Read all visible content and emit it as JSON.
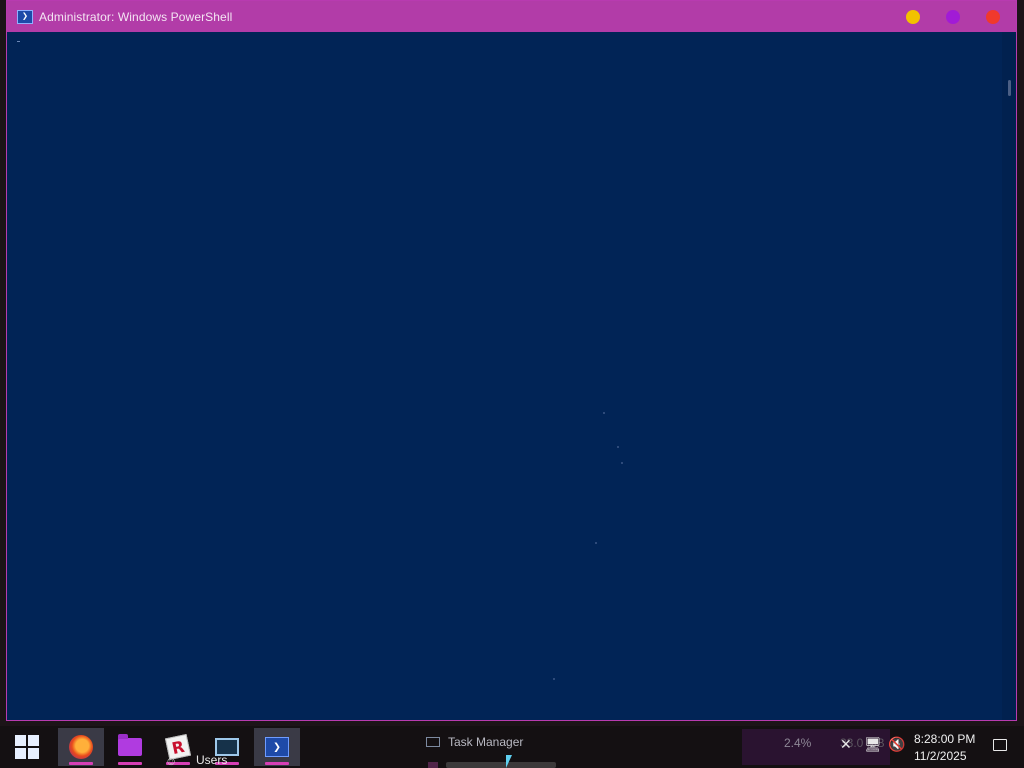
{
  "window": {
    "title": "Administrator: Windows PowerShell",
    "icon": "powershell-icon",
    "colors": {
      "titlebar": "#b23ca8",
      "console_bg": "#012456",
      "minimize": "#f2c200",
      "maximize": "#a11bd6",
      "close": "#f0392c"
    },
    "console_text": ""
  },
  "taskbar": {
    "start_icon": "windows-start-icon",
    "pinned": [
      {
        "name": "firefox",
        "icon": "firefox-icon"
      },
      {
        "name": "file-explorer",
        "icon": "folder-icon"
      },
      {
        "name": "roblox",
        "icon": "roblox-icon"
      },
      {
        "name": "task-manager",
        "icon": "resource-monitor-icon"
      },
      {
        "name": "powershell",
        "icon": "powershell-icon"
      }
    ],
    "users_label": "Users",
    "ghost_window_label": "Task Manager",
    "cpu_value": "2.4%",
    "mem_value": "33.0 MB",
    "accent_color": "#d63fb5"
  },
  "tray": {
    "icons": [
      "chevron-up-icon",
      "network-icon",
      "volume-muted-icon"
    ],
    "time": "8:28:00 PM",
    "date": "11/2/2025",
    "notification_icon": "notification-icon"
  }
}
